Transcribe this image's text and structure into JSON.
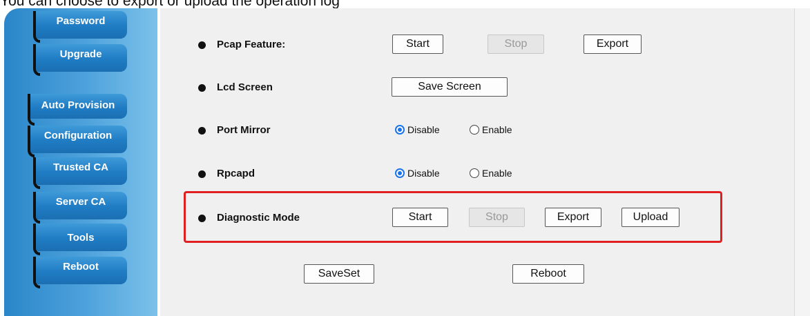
{
  "caption": "You can choose to export or upload the operation log",
  "sidebar": {
    "items": [
      {
        "label": "Password"
      },
      {
        "label": "Upgrade"
      },
      {
        "label": "Auto Provision"
      },
      {
        "label": "Configuration"
      },
      {
        "label": "Trusted CA"
      },
      {
        "label": "Server CA"
      },
      {
        "label": "Tools"
      },
      {
        "label": "Reboot"
      }
    ]
  },
  "rows": {
    "pcap": {
      "label": "Pcap Feature:",
      "start": "Start",
      "stop": "Stop",
      "export": "Export"
    },
    "lcd": {
      "label": "Lcd Screen",
      "save_screen": "Save Screen"
    },
    "port_mirror": {
      "label": "Port Mirror",
      "disable": "Disable",
      "enable": "Enable",
      "selected": "Disable"
    },
    "rpcapd": {
      "label": "Rpcapd",
      "disable": "Disable",
      "enable": "Enable",
      "selected": "Disable"
    },
    "diagnostic": {
      "label": "Diagnostic Mode",
      "start": "Start",
      "stop": "Stop",
      "export": "Export",
      "upload": "Upload"
    }
  },
  "footer": {
    "saveset": "SaveSet",
    "reboot": "Reboot"
  },
  "colors": {
    "highlight": "#e02020",
    "sidebar": "#2a86c9",
    "radio_checked": "#1a73e8"
  }
}
